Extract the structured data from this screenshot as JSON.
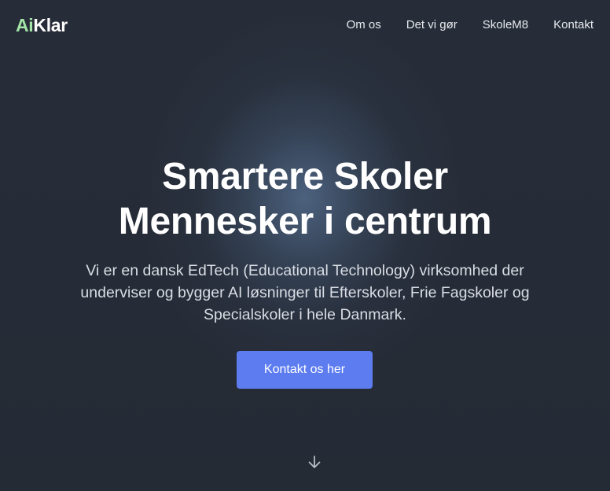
{
  "brand": {
    "logo_part1": "Ai",
    "logo_part2": "Klar",
    "accent_color": "#a3e6a8"
  },
  "nav": {
    "items": [
      {
        "label": "Om os"
      },
      {
        "label": "Det vi gør"
      },
      {
        "label": "SkoleM8"
      },
      {
        "label": "Kontakt"
      }
    ]
  },
  "hero": {
    "headline_line1": "Smartere Skoler",
    "headline_line2": "Mennesker i centrum",
    "subtext": "Vi er en dansk EdTech (Educational Technology) virksomhed der underviser og bygger AI løsninger til Efterskoler, Frie Fagskoler og Specialskoler i hele Danmark.",
    "cta_label": "Kontakt os her",
    "cta_color": "#5c7cf0",
    "scroll_icon": "arrow-down-icon"
  }
}
